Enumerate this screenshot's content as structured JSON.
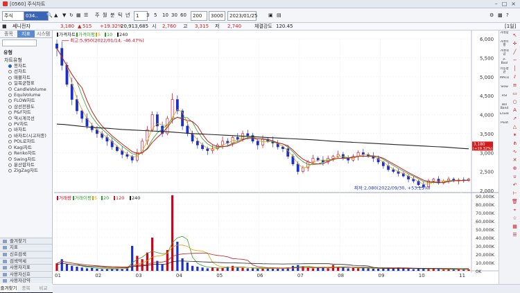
{
  "window": {
    "title": "[0560] 주식차트"
  },
  "toolbar": {
    "market": "주식",
    "code": "034..",
    "periods": [
      "주",
      "월",
      "분",
      "틱",
      "년"
    ],
    "interval": "1",
    "minutes": [
      "3",
      "5",
      "10",
      "30",
      "60"
    ],
    "count": "200",
    "total": "3000",
    "date": "2023/01/25",
    "mode_label": "[1일]"
  },
  "info": {
    "name": "쎄니전자",
    "price": "3,180",
    "change_arrow": "▲",
    "change": "515",
    "change_pct": "+19.32%",
    "volume": "20,913,685",
    "open_label": "시",
    "open": "2,760",
    "high_label": "고",
    "high": "3,315",
    "low_label": "저",
    "low": "2,740",
    "strength_label": "체결강도",
    "strength": "120.45"
  },
  "left_panel": {
    "tabs": [
      "종목",
      "지표",
      "시스템"
    ],
    "active_tab": 1,
    "section": "유형",
    "group": "차트유형",
    "items": [
      "봉차트",
      "선차트",
      "매물차트",
      "일목균형표",
      "CandleVolume",
      "EquiVolume",
      "FLOW차트",
      "삼선전환도",
      "P&F차트",
      "역시계곡선",
      "PV차트",
      "바차트",
      "바차트(시고저종)",
      "POL로차트",
      "Kagi차트",
      "Renko차트",
      "Swing차트",
      "분산합차트",
      "ZigZag차트"
    ],
    "selected": 0,
    "footer_items": [
      "즐겨찾기",
      "지표",
      "신호검색",
      "검색약세",
      "사용자지표",
      "사용자신호",
      "사용자강약"
    ],
    "bottom_tabs": [
      "즐겨찾기",
      "종목",
      "비교"
    ]
  },
  "chart": {
    "price_legend": [
      "가격차트",
      "가격이평",
      "5",
      "10",
      "240"
    ],
    "volume_legend": [
      "거래량",
      "거래이평",
      "5",
      "20",
      "120",
      "240"
    ],
    "max_label": "최고:5,950(2022/01/14, -46.47%)",
    "min_label": "최저:2,080(2022/09/30, +53.13%)",
    "current_price_tag": "3,180",
    "current_pct_tag": "(+19.32%)",
    "colors": {
      "up": "#d0021b",
      "down": "#1a2fd0",
      "ma5": "#e0a000",
      "ma10": "#2a9d2a",
      "ma20": "#c41f1f",
      "ma240": "#222222"
    }
  },
  "chart_data": {
    "type": "candlestick",
    "x_tick_labels": [
      "01",
      "02",
      "03",
      "04",
      "05",
      "06",
      "07",
      "08",
      "09",
      "10",
      "11"
    ],
    "price_axis": [
      "6,000",
      "5,500",
      "5,000",
      "4,500",
      "4,000",
      "3,500",
      "3,000",
      "2,500",
      "2,000"
    ],
    "price_ylim": [
      2000,
      6000
    ],
    "price_close": [
      5750,
      5300,
      4800,
      4400,
      4100,
      3900,
      3700,
      3600,
      3500,
      3400,
      3300,
      3150,
      3050,
      2950,
      2900,
      2800,
      3000,
      3300,
      3600,
      4000,
      3700,
      3500,
      3900,
      4400,
      4100,
      3700,
      3500,
      3300,
      3200,
      3100,
      3050,
      3100,
      3200,
      3300,
      3250,
      3400,
      3350,
      3500,
      3450,
      3300,
      3200,
      3350,
      3300,
      3250,
      3150,
      3100,
      2900,
      2700,
      2500,
      2600,
      2750,
      2850,
      2800,
      2750,
      2850,
      2900,
      2950,
      2850,
      2800,
      2900,
      3000,
      2950,
      2900,
      2850,
      2750,
      2650,
      2550,
      2500,
      2450,
      2380,
      2300,
      2250,
      2150,
      2100,
      2250,
      2300,
      2200,
      2250,
      2300,
      2250,
      2280,
      2260,
      2300
    ],
    "ma240": [
      3750,
      3740,
      3720,
      3700,
      3680,
      3660,
      3650,
      3640,
      3625,
      3610,
      3600,
      3590,
      3580,
      3570,
      3560,
      3550,
      3540,
      3525,
      3510,
      3500,
      3490,
      3480,
      3470,
      3460,
      3450,
      3440,
      3430,
      3420,
      3410,
      3400,
      3390,
      3380,
      3370,
      3360,
      3350,
      3340,
      3330,
      3315,
      3300,
      3290,
      3280,
      3270,
      3260,
      3250,
      3240,
      3230,
      3220,
      3210,
      3200,
      3190,
      3180,
      3170,
      3160,
      3150,
      3140,
      3125,
      3110,
      3100
    ],
    "volume_axis": [
      "90,000K",
      "80,000K",
      "70,000K",
      "60,000K",
      "50,000K",
      "40,000K",
      "30,000K",
      "20,000K",
      "10,000K",
      "0K"
    ],
    "volume_ylim": [
      0,
      90000
    ],
    "volume": [
      9000,
      14000,
      8000,
      6000,
      5000,
      4000,
      3000,
      3500,
      2500,
      2000,
      2000,
      2500,
      3000,
      2500,
      4000,
      30000,
      18000,
      14000,
      22000,
      40000,
      12000,
      8000,
      25000,
      91000,
      35000,
      15000,
      10000,
      6000,
      5000,
      4000,
      3000,
      4000,
      3000,
      3500,
      5000,
      6000,
      4000,
      3500,
      3000,
      3000,
      2500,
      3000,
      2500,
      3000,
      2500,
      3000,
      4000,
      6000,
      7000,
      5000,
      4000,
      3000,
      3500,
      4000,
      3000,
      7000,
      5000,
      4000,
      3000,
      3500,
      3000,
      4000,
      3000,
      2500,
      2500,
      3000,
      3500,
      3000,
      4000,
      3000,
      2500,
      2000,
      2500,
      3000,
      2000,
      2500,
      2000,
      1500,
      2000,
      1500,
      2000,
      1500,
      1800
    ]
  },
  "right_toolbar": {
    "labels": [
      "거래량",
      "거래이평",
      "거래대금",
      "P-Bool",
      "이동평균",
      "MACD",
      "Slow",
      "RSI",
      "Bol Band",
      "Envelope",
      "Pivot"
    ]
  }
}
